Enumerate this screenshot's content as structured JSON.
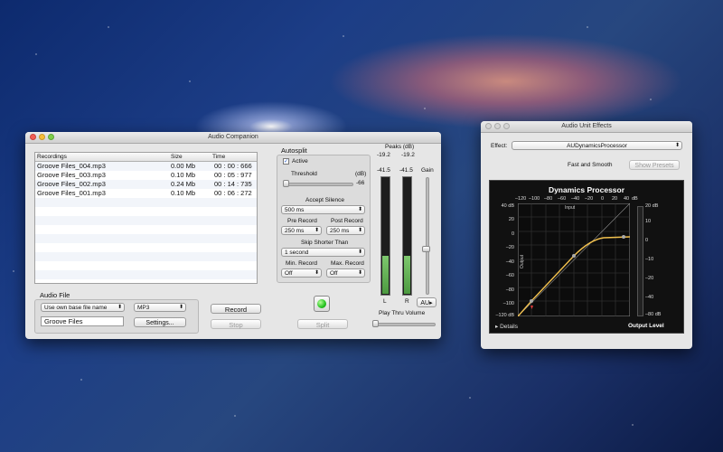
{
  "companion": {
    "title": "Audio Companion",
    "table": {
      "headers": [
        "Recordings",
        "Size",
        "Time"
      ],
      "rows": [
        {
          "name": "Groove Files_004.mp3",
          "size": "0.00 Mb",
          "time": "00 : 00 : 666"
        },
        {
          "name": "Groove Files_003.mp3",
          "size": "0.10 Mb",
          "time": "00 : 05 : 977"
        },
        {
          "name": "Groove Files_002.mp3",
          "size": "0.24 Mb",
          "time": "00 : 14 : 735"
        },
        {
          "name": "Groove Files_001.mp3",
          "size": "0.10 Mb",
          "time": "00 : 06 : 272"
        }
      ]
    },
    "audio_file": {
      "label": "Audio File",
      "naming": "Use own base file name",
      "format": "MP3",
      "base_name": "Groove Files",
      "settings_label": "Settings..."
    },
    "record_label": "Record",
    "stop_label": "Stop",
    "autosplit": {
      "label": "Autosplit",
      "active_label": "Active",
      "threshold_label": "Threshold",
      "db_unit": "(dB)",
      "threshold_value": "-66",
      "accept_silence_label": "Accept Silence",
      "accept_silence": "500 ms",
      "pre_record_label": "Pre Record",
      "pre_record": "250 ms",
      "post_record_label": "Post Record",
      "post_record": "250 ms",
      "skip_label": "Skip Shorter Than",
      "skip": "1 second",
      "min_record_label": "Min. Record",
      "min_record": "Off",
      "max_record_label": "Max. Record",
      "max_record": "Off",
      "split_label": "Split"
    },
    "meters": {
      "peaks_label": "Peaks (dB)",
      "peak_left": "-19.2",
      "peak_right": "-19.2",
      "level_left": "-41.5",
      "level_right": "-41.5",
      "left_label": "L",
      "right_label": "R",
      "gain_label": "Gain",
      "au_label": "AU▸",
      "play_thru_label": "Play Thru Volume"
    }
  },
  "effects": {
    "title": "Audio Unit Effects",
    "effect_label": "Effect:",
    "effect_value": "AUDynamicsProcessor",
    "preset_name": "Fast and Smooth",
    "show_presets_label": "Show Presets",
    "processor": {
      "title": "Dynamics Processor",
      "x_ticks": [
        "–120",
        "–100",
        "–80",
        "–60",
        "–40",
        "–20",
        "0",
        "20",
        "40"
      ],
      "x_unit": "dB",
      "input_label": "Input",
      "output_label": "Output",
      "y_ticks": [
        "40 dB",
        "20",
        "0",
        "–20",
        "–40",
        "–60",
        "–80",
        "–100",
        "–120 dB"
      ],
      "right_ticks": [
        "20 dB",
        "10",
        "0",
        "–10",
        "–20",
        "–40",
        "–80 dB"
      ],
      "details_label": "Details",
      "output_level_label": "Output Level"
    }
  }
}
